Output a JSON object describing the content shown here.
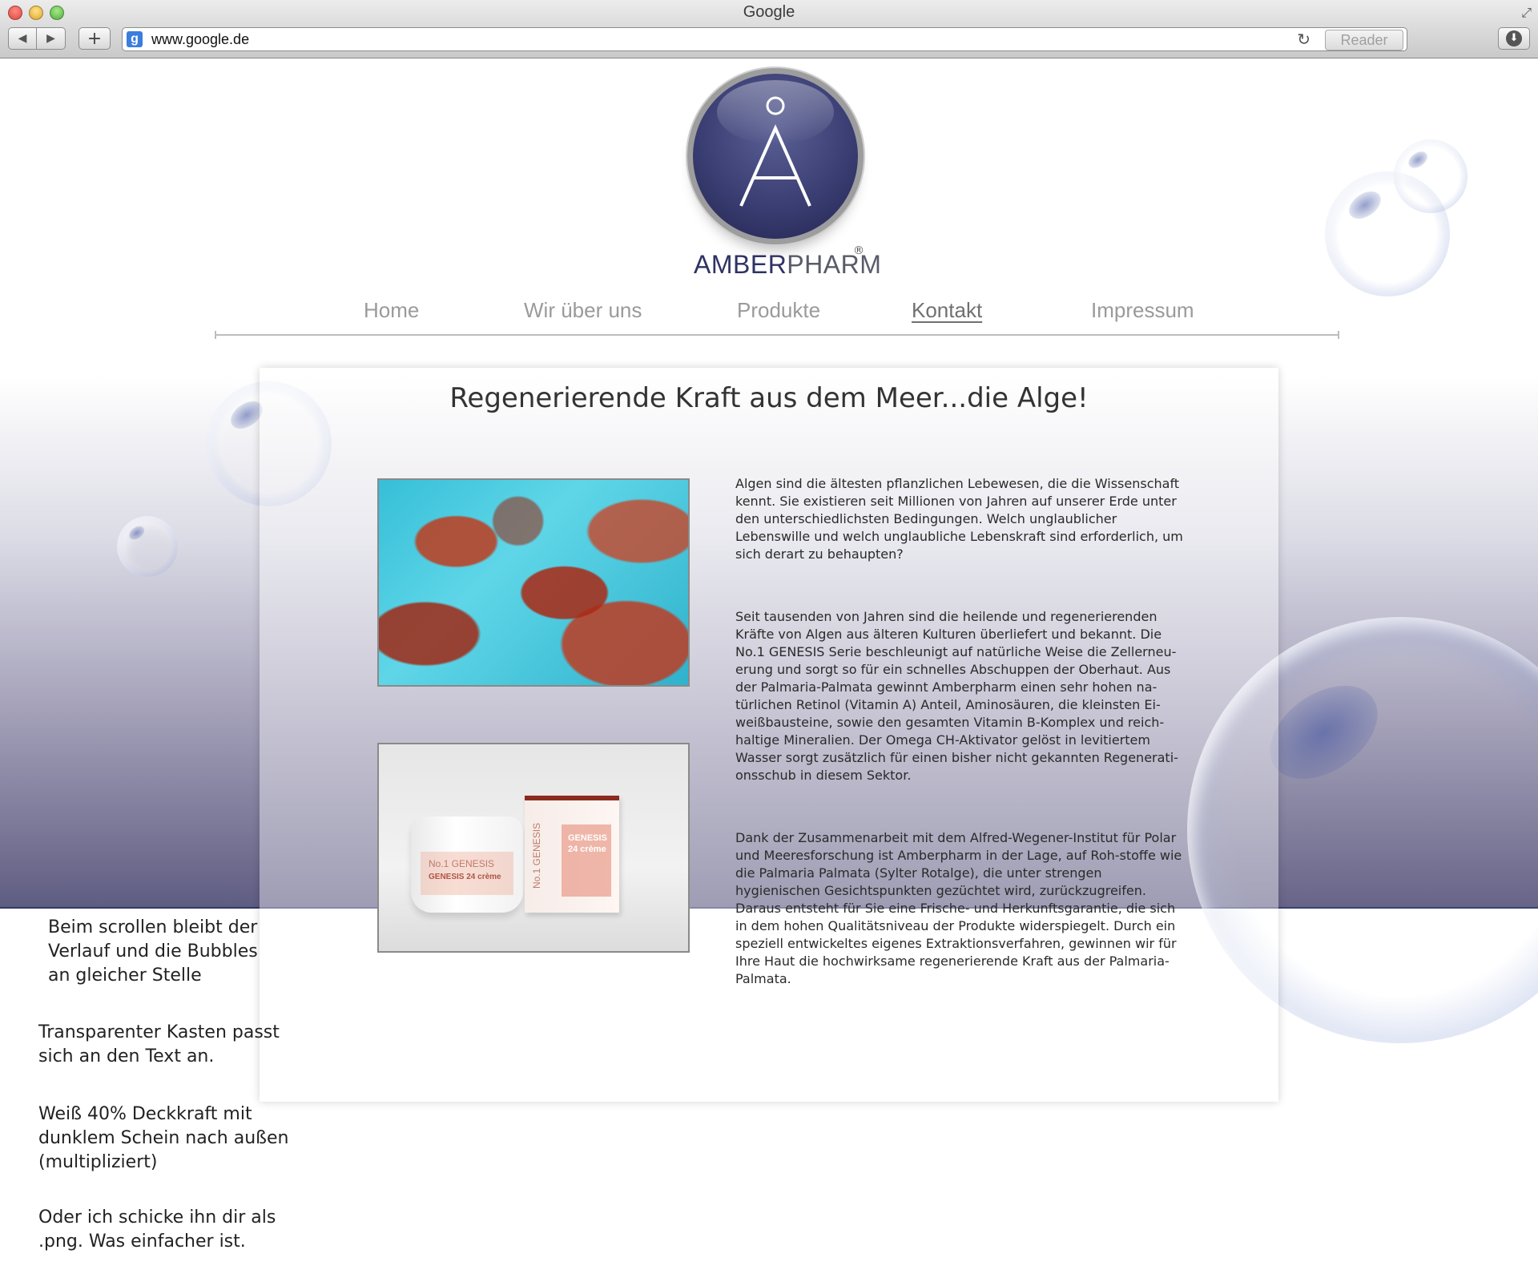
{
  "browser": {
    "window_title": "Google",
    "url": "www.google.de",
    "reader_label": "Reader",
    "favicon_letter": "g"
  },
  "logo": {
    "brand_part1": "AMBER",
    "brand_part2": "PHARM",
    "registered": "®"
  },
  "nav": {
    "items": [
      {
        "label": "Home"
      },
      {
        "label": "Wir über uns"
      },
      {
        "label": "Produkte"
      },
      {
        "label": "Kontakt",
        "active": true
      },
      {
        "label": "Impressum"
      }
    ]
  },
  "content": {
    "title": "Regenerierende Kraft aus dem Meer...die Alge!",
    "paragraphs": [
      "Algen sind die ältesten pflanzlichen Lebewesen, die die Wissenschaft kennt.  Sie existieren seit Millionen von Jahren auf unserer Erde unter den unterschiedlichsten Bedingungen. Welch unglaublicher Lebenswille und welch unglaubliche Lebenskraft sind erforderlich, um sich derart zu behaupten?",
      "Seit tausenden von Jahren sind die heilende und regenerierenden Kräfte von Algen aus älteren Kulturen überliefert und bekannt. Die No.1 GENESIS Serie beschleunigt auf natürliche Weise die Zellerneu-erung und sorgt so für ein schnelles Abschuppen der Oberhaut. Aus der Palmaria-Palmata gewinnt Amberpharm einen sehr hohen na-türlichen Retinol (Vitamin A) Anteil, Aminosäuren, die kleinsten Ei-weißbausteine, sowie den gesamten Vitamin B-Komplex und reich-haltige Mineralien. Der Omega CH-Aktivator gelöst in levitiertem Wasser sorgt zusätzlich für einen bisher nicht gekannten Regenerati-onsschub in diesem Sektor.",
      "Dank der Zusammenarbeit mit dem Alfred-Wegener-Institut für Polar und Meeresforschung ist Amberpharm in der Lage, auf Roh-stoffe wie die Palmaria Palmata (Sylter Rotalge), die unter strengen hygienischen Gesichtspunkten gezüchtet wird, zurückzugreifen. Daraus entsteht für Sie eine Frische- und Herkunftsgarantie, die sich in dem hohen Qualitätsniveau der Produkte widerspiegelt. Durch ein speziell entwickeltes eigenes Extraktionsverfahren, gewinnen wir für Ihre Haut die hochwirksame regenerierende Kraft aus der Palmaria-Palmata."
    ],
    "product_image": {
      "jar_line1": "No.1  GENESIS",
      "jar_line2": "GENESIS 24 crème",
      "box_label": "GENESIS 24 crème",
      "box_side": "No.1  GENESIS"
    }
  },
  "notes": [
    "Beim scrollen bleibt der Verlauf und die Bubbles an gleicher Stelle",
    "Transparenter Kasten passt sich an den Text an.",
    "Weiß 40% Deckkraft mit dunklem Schein nach außen (multipliziert)",
    "Oder ich schicke ihn dir als .png. Was einfacher ist."
  ],
  "colors": {
    "logo_navy": "#3a3e73",
    "gradient_bottom": "#5f5c82",
    "nav_text": "#9a9a9a"
  }
}
